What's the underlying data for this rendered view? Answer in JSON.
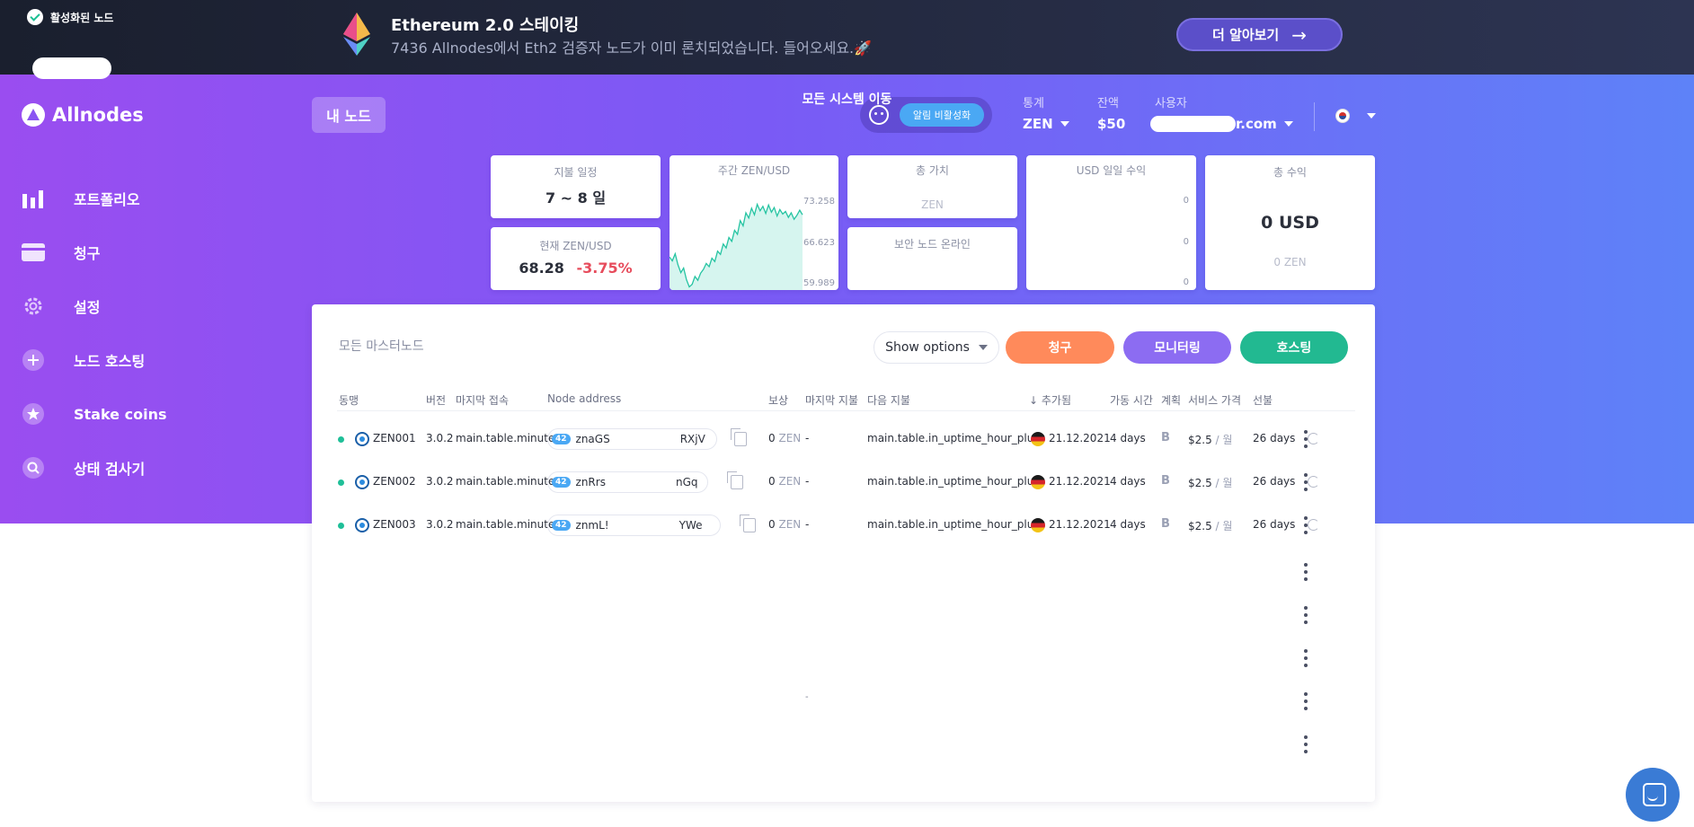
{
  "banner": {
    "title": "Ethereum 2.0 스테이킹",
    "subtitle": "7436 Allnodes에서 Eth2 검증자 노드가 이미 론치되었습니다. 들어오세요.🚀",
    "button_label": "더 알아보기",
    "button_arrow": "→"
  },
  "app": {
    "name": "Allnodes"
  },
  "sidebar": {
    "items": [
      {
        "label": "포트폴리오",
        "icon": "bar-chart-icon"
      },
      {
        "label": "청구",
        "icon": "credit-card-icon"
      },
      {
        "label": "설정",
        "icon": "gear-icon"
      },
      {
        "label": "노드 호스팅",
        "icon": "plus-circle-icon"
      },
      {
        "label": "Stake coins",
        "icon": "star-circle-icon"
      },
      {
        "label": "상태 검사기",
        "icon": "search-circle-icon"
      }
    ]
  },
  "header": {
    "tab_label": "내 노드",
    "alarm_button": "알림 비활성화",
    "stats_label": "통계",
    "stats_value": "ZEN",
    "balance_label": "잔액",
    "balance_value": "$50",
    "user_label": "사용자",
    "user_value": "r.com",
    "language_icon": "korea-flag-icon"
  },
  "cards": {
    "active": {
      "title": "활성화된 노드",
      "link": "모든 시스템 이동"
    },
    "payout_schedule": {
      "label": "지불 일정",
      "value": "7 ~ 8 일"
    },
    "current_price": {
      "label": "현재 ZEN/USD",
      "value": "68.28",
      "change": "-3.75%"
    },
    "weekly_chart": {
      "label": "주간 ZEN/USD",
      "ticks": [
        "73.258",
        "66.623",
        "59.989"
      ]
    },
    "total_value": {
      "label": "총 가치",
      "unit": "ZEN"
    },
    "secure_nodes": {
      "label": "보안 노드 온라인"
    },
    "usd_daily": {
      "label": "USD 일일 수익",
      "ticks": [
        "0",
        "0",
        "0"
      ]
    },
    "total_earnings": {
      "label": "총 수익",
      "value": "0 USD",
      "sub": "0 ZEN"
    }
  },
  "chart_data": {
    "type": "area",
    "title": "주간 ZEN/USD",
    "ylim": [
      59.989,
      73.258
    ],
    "yticks": [
      73.258,
      66.623,
      59.989
    ],
    "values": [
      64.8,
      64.2,
      65.3,
      63.6,
      62.4,
      63.1,
      61.3,
      60.2,
      60.6,
      61.8,
      61.2,
      62.3,
      62.9,
      63.8,
      63.3,
      64.6,
      64.1,
      65.7,
      65.2,
      66.8,
      66.2,
      67.8,
      67.2,
      68.9,
      68.3,
      70.4,
      69.6,
      71.6,
      70.8,
      72.3,
      71.3,
      72.9,
      71.9,
      72.6,
      71.5,
      72.8,
      71.7,
      72.4,
      71.1,
      72.1,
      71.4,
      71.8,
      70.9,
      71.6,
      70.6,
      71.2,
      72.0,
      71.3
    ]
  },
  "table": {
    "title": "모든 마스터노드",
    "show_options": "Show options",
    "buttons": {
      "billing": "청구",
      "monitoring": "모니터링",
      "hosting": "호스팅"
    },
    "colors": {
      "billing": "#ff8a5b",
      "monitoring": "#8c6cf2",
      "hosting": "#22b991"
    },
    "headers": {
      "alias": "동맹",
      "version": "버전",
      "last_seen": "마지막 접속",
      "address": "Node address",
      "reward": "보상",
      "last_paid": "마지막 지불",
      "next_paid": "다음 지불",
      "added_arrow": "↓",
      "added": "추가됨",
      "uptime": "가동 시간",
      "plan": "계획",
      "price": "서비스 가격",
      "prepaid": "선불"
    },
    "rows": [
      {
        "alias": "ZEN001",
        "version": "3.0.2",
        "last_seen": "main.table.minute",
        "addr_prefix": "znaGS",
        "addr_suffix": "RXjV",
        "reward": "0",
        "reward_unit": "ZEN",
        "last_paid": "-",
        "next_paid": "main.table.in_uptime_hour_plus",
        "added": "21.12.2021",
        "uptime": "4 days",
        "plan": "B",
        "price": "$2.5",
        "price_unit": "/ 월",
        "prepaid": "26 days"
      },
      {
        "alias": "ZEN002",
        "version": "3.0.2",
        "last_seen": "main.table.minute",
        "addr_prefix": "znRrs",
        "addr_suffix": "nGq",
        "reward": "0",
        "reward_unit": "ZEN",
        "last_paid": "-",
        "next_paid": "main.table.in_uptime_hour_plus",
        "added": "21.12.2021",
        "uptime": "4 days",
        "plan": "B",
        "price": "$2.5",
        "price_unit": "/ 월",
        "prepaid": "26 days"
      },
      {
        "alias": "ZEN003",
        "version": "3.0.2",
        "last_seen": "main.table.minute",
        "addr_prefix": "znmL!",
        "addr_suffix": "YWe",
        "reward": "0",
        "reward_unit": "ZEN",
        "last_paid": "-",
        "next_paid": "main.table.in_uptime_hour_plus",
        "added": "21.12.2021",
        "uptime": "4 days",
        "plan": "B",
        "price": "$2.5",
        "price_unit": "/ 월",
        "prepaid": "26 days"
      }
    ],
    "faded_last_paid": "-"
  }
}
